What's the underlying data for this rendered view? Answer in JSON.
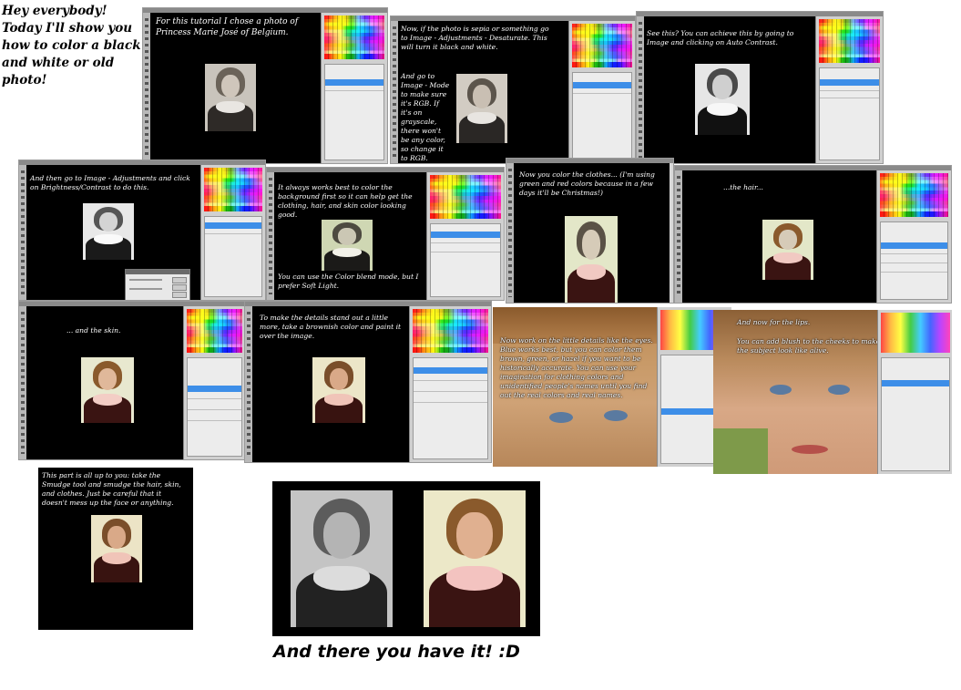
{
  "intro_text": "Hey everybody! Today I'll show you how to color a black and white or old photo!",
  "steps": [
    {
      "id": 1,
      "caption": "For this tutorial I chose a photo of Princess Marie José of Belgium."
    },
    {
      "id": 2,
      "caption_a": "Now, if the photo is sepia or something go to Image - Adjustments - Desaturate. This will turn it black and white.",
      "caption_b": "And go to Image - Mode to make sure it's RGB. If it's on grayscale, there won't be any color, so change it to RGB."
    },
    {
      "id": 3,
      "caption": "See this? You can achieve this by going to Image and clicking on Auto Contrast."
    },
    {
      "id": 4,
      "caption": "And then go to Image - Adjustments and click on Brightness/Contrast to do this."
    },
    {
      "id": 5,
      "caption_a": "It always works best to color the background first so it can help get the clothing, hair, and skin color looking good.",
      "caption_b": "You can use the Color blend mode, but I prefer Soft Light."
    },
    {
      "id": 6,
      "caption": "Now you color the clothes... (I'm using green and red colors because in a few days it'll be Christmas!)"
    },
    {
      "id": 7,
      "caption": "...the hair..."
    },
    {
      "id": 8,
      "caption": "... and the skin."
    },
    {
      "id": 9,
      "caption": "To make the details stand out a little more, take a brownish color and paint it over the image."
    },
    {
      "id": 10,
      "caption": "Now work on the little details like the eyes. Blue works best, but you can color them brown, green, or hazel if you want to be historically accurate. You can use your imagination for clothing colors and unidentified people's names until you find out the real colors and real names."
    },
    {
      "id": 11,
      "caption_a": "And now for the lips.",
      "caption_b": "You can add blush to the cheeks to make the subject look like alive."
    },
    {
      "id": 12,
      "caption": "This part is all up to you: take the Smudge tool and smudge the hair, skin, and clothes. Just be careful that it doesn't mess up the face or anything."
    }
  ],
  "final_caption": "And there you have it! :D",
  "colors": {
    "canvas_bg": "#000000",
    "caption_text": "#ffffff",
    "layer_highlight": "#3d8ee8",
    "app_chrome": "#d8d8d8"
  }
}
